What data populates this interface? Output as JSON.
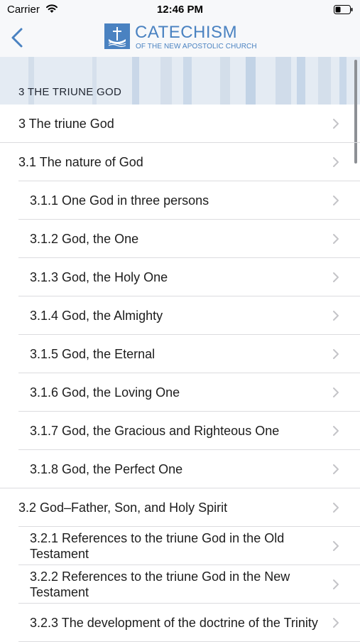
{
  "status_bar": {
    "carrier": "Carrier",
    "time": "12:46 PM",
    "wifi_icon": "wifi-icon",
    "battery_icon": "battery-icon"
  },
  "nav": {
    "back_icon": "chevron-left-icon",
    "logo_title": "CATECHISM",
    "logo_subtitle": "OF THE NEW APOSTOLIC CHURCH",
    "accent_color": "#4a82c1"
  },
  "section": {
    "title": "3 THE TRIUNE GOD"
  },
  "list": {
    "chevron_icon": "chevron-right-icon",
    "items": [
      {
        "label": "3 The triune God",
        "level": 0
      },
      {
        "label": "3.1 The nature of God",
        "level": 0
      },
      {
        "label": "3.1.1 One God in three persons",
        "level": 1
      },
      {
        "label": "3.1.2 God, the One",
        "level": 1
      },
      {
        "label": "3.1.3 God, the Holy One",
        "level": 1
      },
      {
        "label": "3.1.4 God, the Almighty",
        "level": 1
      },
      {
        "label": "3.1.5 God, the Eternal",
        "level": 1
      },
      {
        "label": "3.1.6 God, the Loving One",
        "level": 1
      },
      {
        "label": "3.1.7 God, the Gracious and Righteous One",
        "level": 1
      },
      {
        "label": "3.1.8 God, the Perfect One",
        "level": 1
      },
      {
        "label": "3.2 God–Father, Son, and Holy Spirit",
        "level": 0
      },
      {
        "label": "3.2.1 References to the triune God in the Old Testament",
        "level": 1
      },
      {
        "label": "3.2.2 References to the triune God in the New Testament",
        "level": 1
      },
      {
        "label": "3.2.3 The development of the doctrine of the Trinity",
        "level": 1
      }
    ]
  }
}
